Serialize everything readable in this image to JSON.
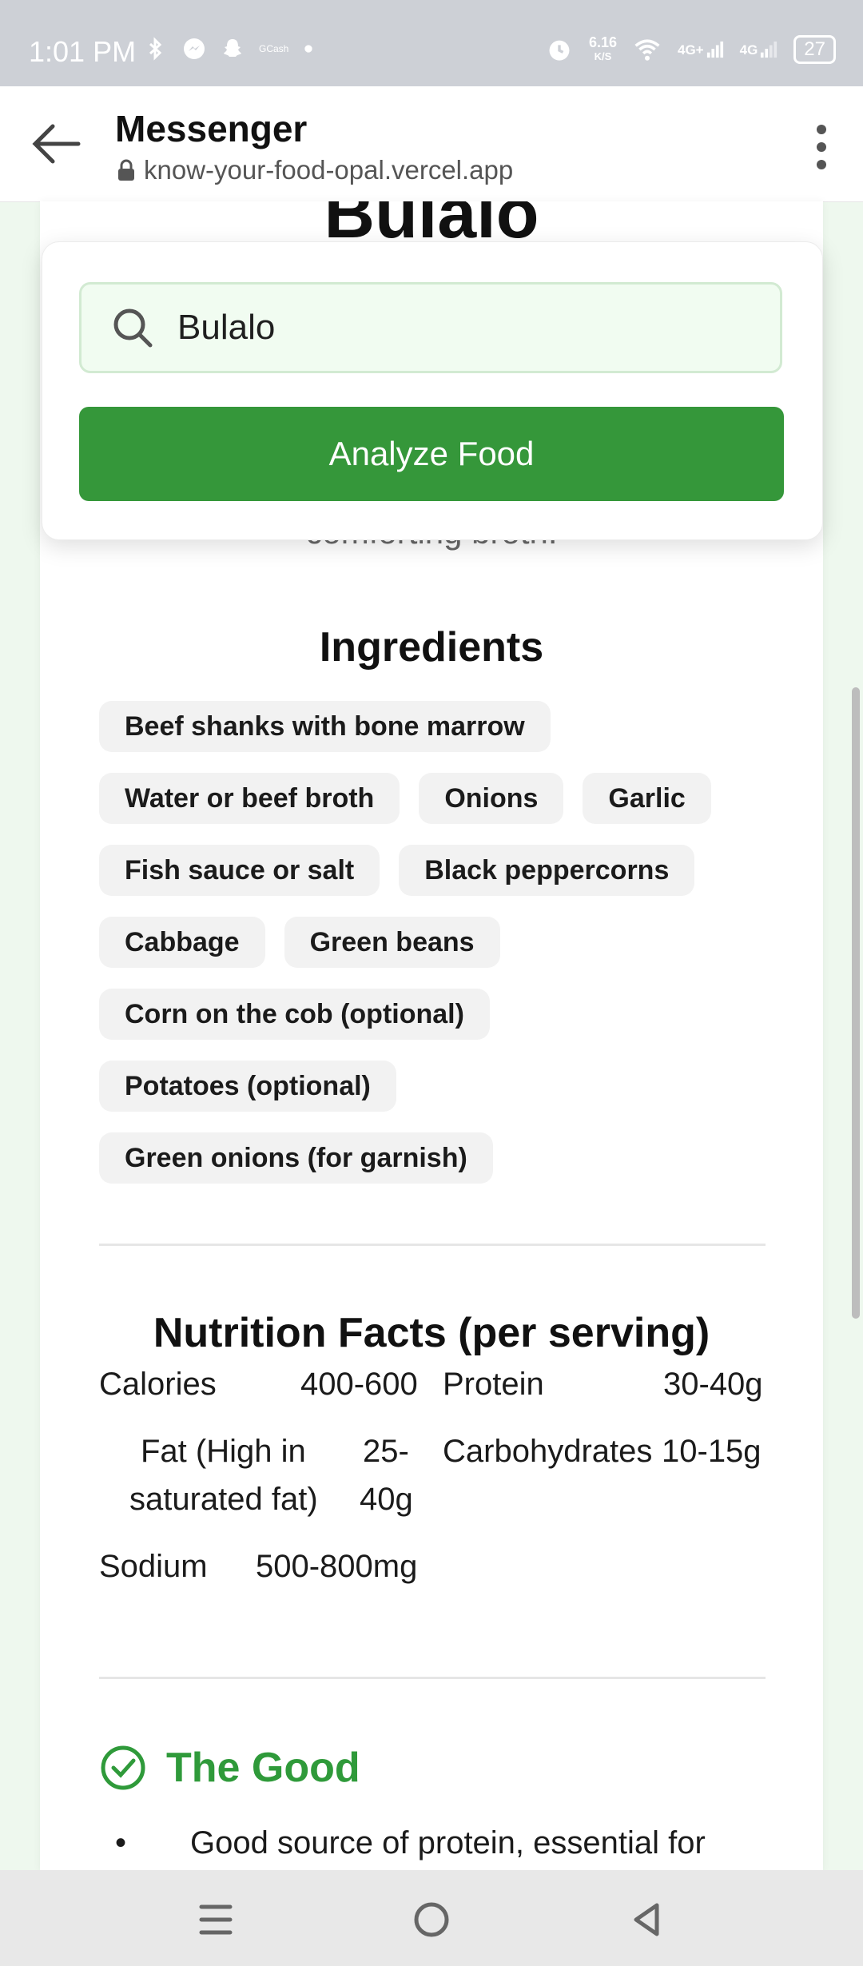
{
  "status_bar": {
    "time": "1:01 PM",
    "left_icons": [
      "bluetooth-icon",
      "messenger-icon",
      "snapchat-icon",
      "gcash-icon",
      "dot-icon"
    ],
    "gcash_label": "GCash",
    "speed": "6.16",
    "speed_unit": "K/S",
    "net1": "4G+",
    "net2": "4G",
    "battery": "27"
  },
  "browser": {
    "app_title": "Messenger",
    "url": "know-your-food-opal.vercel.app"
  },
  "food": {
    "title": "Bulalo",
    "desc_fragment": "comforting broth."
  },
  "search": {
    "value": "Bulalo",
    "button_label": "Analyze Food"
  },
  "ingredients": {
    "heading": "Ingredients",
    "rows": [
      [
        "Beef shanks with bone marrow"
      ],
      [
        "Water or beef broth",
        "Onions",
        "Garlic"
      ],
      [
        "Fish sauce or salt",
        "Black peppercorns"
      ],
      [
        "Cabbage",
        "Green beans"
      ],
      [
        "Corn on the cob (optional)"
      ],
      [
        "Potatoes (optional)"
      ],
      [
        "Green onions (for garnish)"
      ]
    ]
  },
  "nutrition": {
    "heading": "Nutrition Facts (per serving)",
    "calories_label": "Calories",
    "calories_value": "400-600",
    "protein_label": "Protein",
    "protein_value": "30-40g",
    "fat_label_1": "Fat (High in",
    "fat_label_2": "saturated fat)",
    "fat_value_1": "25-",
    "fat_value_2": "40g",
    "carbs_label": "Carbohydrates",
    "carbs_value": "10-15g",
    "sodium_label": "Sodium",
    "sodium_value": "500-800mg"
  },
  "good": {
    "heading": "The Good",
    "bullet": "•",
    "item1": "Good source of protein, essential for"
  },
  "colors": {
    "accent_green": "#35973a",
    "good_green": "#2f9a3a",
    "status_bar": "#cdd0d6"
  }
}
